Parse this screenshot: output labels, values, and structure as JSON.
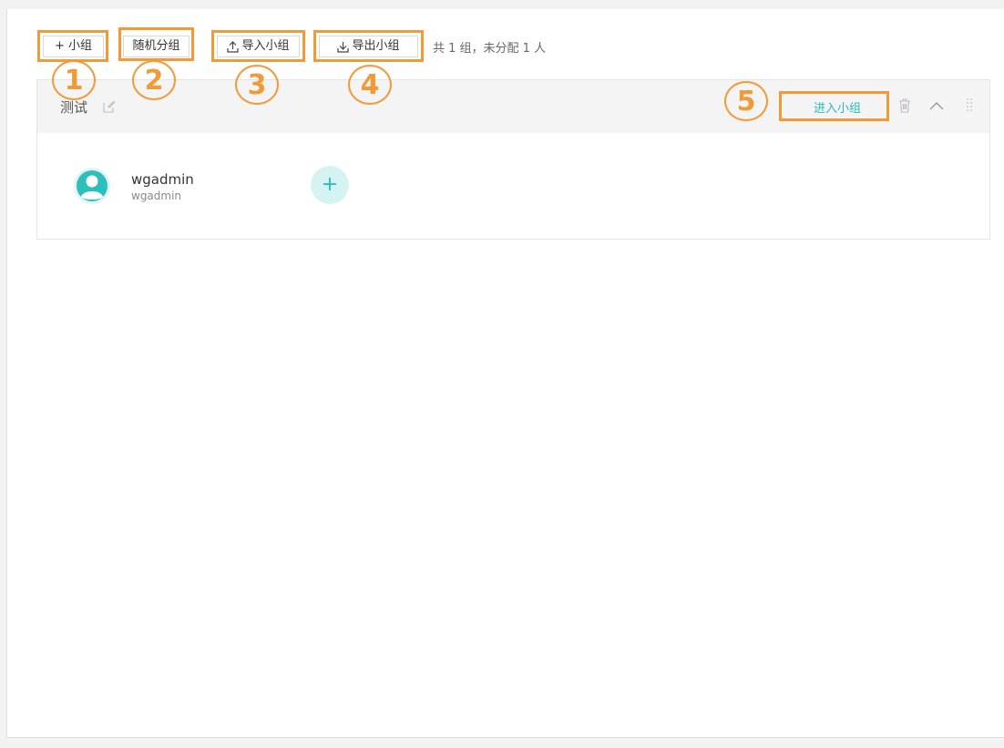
{
  "toolbar": {
    "add_group": "+ 小组",
    "random_group": "随机分组",
    "import_group": "导入小组",
    "export_group": "导出小组",
    "summary": "共 1 组，未分配 1 人"
  },
  "annotations": [
    "1",
    "2",
    "3",
    "4",
    "5"
  ],
  "group": {
    "name": "测试",
    "enter_label": "进入小组",
    "members": [
      {
        "name": "wgadmin",
        "username": "wgadmin"
      }
    ],
    "add_member_label": "+"
  },
  "colors": {
    "highlight": "#f19a38",
    "accent": "#25bdb8",
    "add_bg": "#d6f3f3"
  },
  "icons": [
    "edit-icon",
    "trash-icon",
    "chevron-up-icon",
    "drag-handle-icon",
    "upload-icon",
    "download-icon",
    "avatar-icon"
  ]
}
